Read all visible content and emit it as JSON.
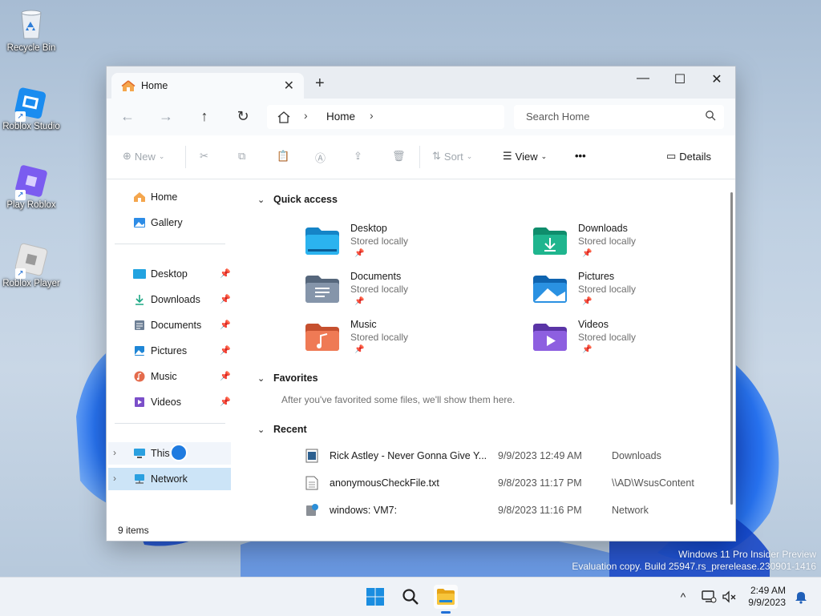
{
  "desktop": {
    "icons": [
      {
        "label": "Recycle Bin",
        "icon": "recycle-bin-icon"
      },
      {
        "label": "Roblox Studio",
        "icon": "roblox-studio-icon"
      },
      {
        "label": "Play Roblox",
        "icon": "roblox-icon"
      },
      {
        "label": "Roblox Player",
        "icon": "roblox-player-icon"
      }
    ],
    "watermark": {
      "line1": "Windows 11 Pro Insider Preview",
      "line2": "Evaluation copy. Build 25947.rs_prerelease.230901-1416"
    }
  },
  "window": {
    "tab": {
      "title": "Home",
      "close": "✕"
    },
    "new_tab": "+",
    "controls": {
      "minimize": "—",
      "maximize": "☐",
      "close": "✕"
    },
    "nav": {
      "back": "←",
      "forward": "→",
      "up": "↑",
      "refresh": "↻"
    },
    "breadcrumb": {
      "current": "Home",
      "sep": "›"
    },
    "search": {
      "placeholder": "Search Home"
    },
    "toolbar": {
      "new": "New",
      "sort": "Sort",
      "view": "View",
      "more": "•••",
      "details": "Details"
    },
    "sidebar": {
      "top": [
        {
          "label": "Home",
          "icon": "home-icon"
        },
        {
          "label": "Gallery",
          "icon": "gallery-icon"
        }
      ],
      "pinned": [
        {
          "label": "Desktop",
          "icon": "desktop-folder-icon"
        },
        {
          "label": "Downloads",
          "icon": "download-icon"
        },
        {
          "label": "Documents",
          "icon": "documents-icon"
        },
        {
          "label": "Pictures",
          "icon": "pictures-icon"
        },
        {
          "label": "Music",
          "icon": "music-icon"
        },
        {
          "label": "Videos",
          "icon": "videos-icon"
        }
      ],
      "bottom": [
        {
          "label": "This PC",
          "icon": "pc-icon"
        },
        {
          "label": "Network",
          "icon": "network-icon"
        }
      ],
      "pin_glyph": "📌"
    },
    "content": {
      "quick_access_title": "Quick access",
      "quick_access": [
        {
          "name": "Desktop",
          "sub": "Stored locally",
          "color": "#1a9ad6",
          "icon": "desktop-folder-icon"
        },
        {
          "name": "Downloads",
          "sub": "Stored locally",
          "color": "#1ba784",
          "icon": "downloads-folder-icon"
        },
        {
          "name": "Documents",
          "sub": "Stored locally",
          "color": "#6d7f95",
          "icon": "documents-folder-icon"
        },
        {
          "name": "Pictures",
          "sub": "Stored locally",
          "color": "#1f86d6",
          "icon": "pictures-folder-icon"
        },
        {
          "name": "Music",
          "sub": "Stored locally",
          "color": "#e46b4c",
          "icon": "music-folder-icon"
        },
        {
          "name": "Videos",
          "sub": "Stored locally",
          "color": "#7b4fc9",
          "icon": "videos-folder-icon"
        }
      ],
      "favorites_title": "Favorites",
      "favorites_hint": "After you've favorited some files, we'll show them here.",
      "recent_title": "Recent",
      "recent": [
        {
          "name": "Rick Astley - Never Gonna Give Y...",
          "date": "9/9/2023 12:49 AM",
          "location": "Downloads",
          "icon": "image-file-icon"
        },
        {
          "name": "anonymousCheckFile.txt",
          "date": "9/8/2023 11:17 PM",
          "location": "\\\\AD\\WsusContent",
          "icon": "text-file-icon"
        },
        {
          "name": "windows: VM7:",
          "date": "9/8/2023 11:16 PM",
          "location": "Network",
          "icon": "network-drive-icon"
        }
      ]
    },
    "status": "9 items"
  },
  "taskbar": {
    "time": "2:49 AM",
    "date": "9/9/2023",
    "tray_chevron": "^"
  }
}
